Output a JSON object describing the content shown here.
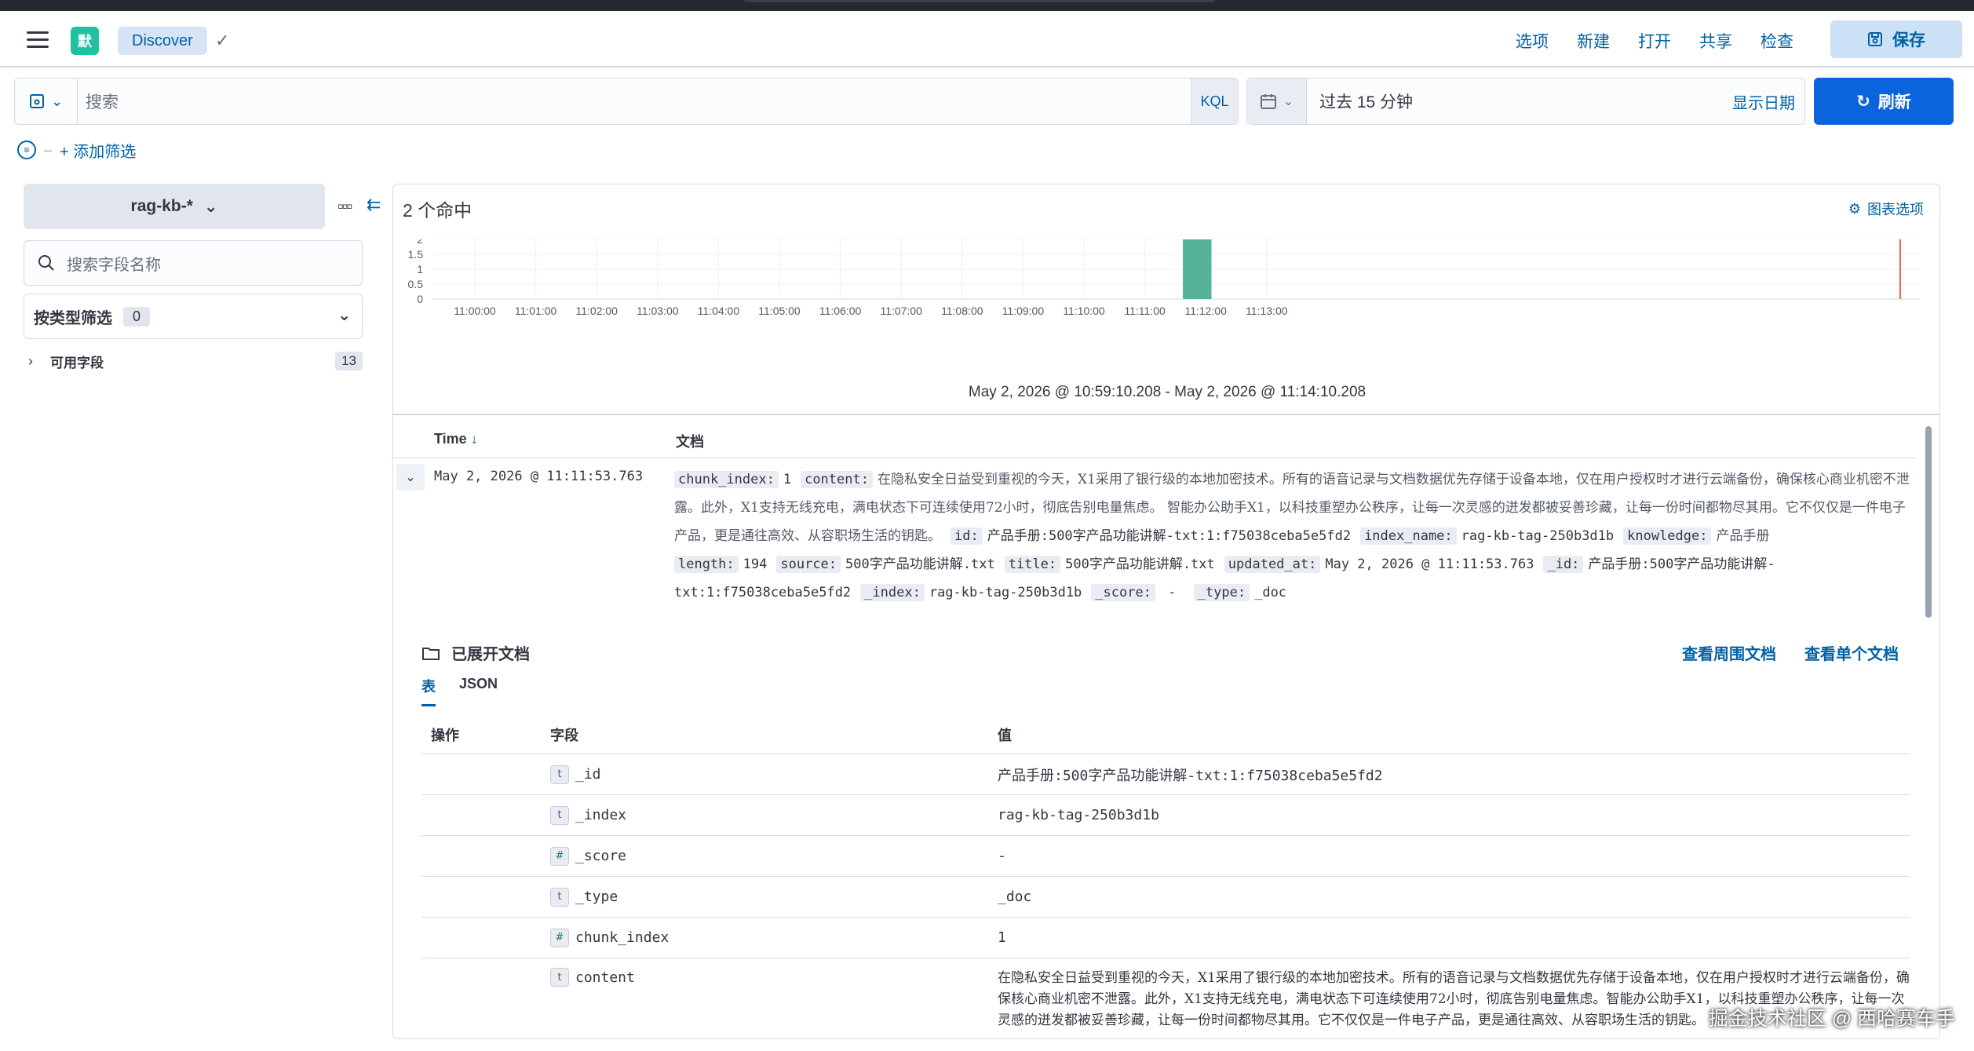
{
  "header": {
    "space_initial": "默",
    "app_tab": "Discover",
    "links": [
      "选项",
      "新建",
      "打开",
      "共享",
      "检查"
    ],
    "save_label": "保存"
  },
  "query": {
    "placeholder": "搜索",
    "language": "KQL",
    "time_range": "过去 15 分钟",
    "show_dates": "显示日期",
    "refresh_label": "刷新"
  },
  "filters": {
    "add_label": "+ 添加筛选"
  },
  "sidebar": {
    "index_pattern": "rag-kb-*",
    "field_search_placeholder": "搜索字段名称",
    "type_filter_label": "按类型筛选",
    "type_filter_count": "0",
    "available_fields_label": "可用字段",
    "available_fields_count": "13"
  },
  "results": {
    "hits": "2 个命中",
    "chart_options": "图表选项",
    "range_label": "May 2, 2026 @ 10:59:10.208 - May 2, 2026 @ 11:14:10.208",
    "col_time": "Time",
    "col_doc": "文档"
  },
  "chart_data": {
    "type": "bar",
    "categories": [
      "11:00:00",
      "11:01:00",
      "11:02:00",
      "11:03:00",
      "11:04:00",
      "11:05:00",
      "11:06:00",
      "11:07:00",
      "11:08:00",
      "11:09:00",
      "11:10:00",
      "11:11:00",
      "11:12:00",
      "11:13:00"
    ],
    "values": [
      0,
      0,
      0,
      0,
      0,
      0,
      0,
      0,
      0,
      0,
      0,
      0,
      2,
      0
    ],
    "yticks": [
      "2",
      "1.5",
      "1",
      "0.5",
      "0"
    ],
    "ylim": [
      0,
      2
    ],
    "bar_color": "#54b399",
    "now_marker_color": "#e7664c"
  },
  "document": {
    "time": "May 2, 2026 @ 11:11:53.763",
    "pairs": [
      {
        "k": "chunk_index:",
        "v": "1",
        "t": "v"
      },
      {
        "k": "content:",
        "v": "在隐私安全日益受到重视的今天，X1采用了银行级的本地加密技术。所有的语音记录与文档数据优先存储于设备本地，仅在用户授权时才进行云端备份，确保核心商业机密不泄露。此外，X1支持无线充电，满电状态下可连续使用72小时，彻底告别电量焦虑。 智能办公助手X1，以科技重塑办公秩序，让每一次灵感的迸发都被妥善珍藏，让每一份时间都物尽其用。它不仅仅是一件电子产品，更是通往高效、从容职场生活的钥匙。",
        "t": "z"
      },
      {
        "k": "id:",
        "v": "产品手册:500字产品功能讲解-txt:1:f75038ceba5e5fd2",
        "t": "v"
      },
      {
        "k": "index_name:",
        "v": "rag-kb-tag-250b3d1b",
        "t": "v"
      },
      {
        "k": "knowledge:",
        "v": "产品手册",
        "t": "z"
      },
      {
        "k": "length:",
        "v": "194",
        "t": "v"
      },
      {
        "k": "source:",
        "v": "500字产品功能讲解.txt",
        "t": "v"
      },
      {
        "k": "title:",
        "v": "500字产品功能讲解.txt",
        "t": "v"
      },
      {
        "k": "updated_at:",
        "v": "May 2, 2026 @ 11:11:53.763",
        "t": "v"
      },
      {
        "k": "_id:",
        "v": "产品手册:500字产品功能讲解-txt:1:f75038ceba5e5fd2",
        "t": "v"
      },
      {
        "k": "_index:",
        "v": "rag-kb-tag-250b3d1b",
        "t": "v"
      },
      {
        "k": "_score:",
        "v": " - ",
        "t": "v"
      },
      {
        "k": "_type:",
        "v": "_doc",
        "t": "v"
      }
    ]
  },
  "expanded": {
    "title": "已展开文档",
    "view_surrounding": "查看周围文档",
    "view_single": "查看单个文档",
    "tab_table": "表",
    "tab_json": "JSON",
    "col_action": "操作",
    "col_field": "字段",
    "col_value": "值",
    "rows": [
      {
        "type": "t",
        "field": "_id",
        "value": "产品手册:500字产品功能讲解-txt:1:f75038ceba5e5fd2"
      },
      {
        "type": "t",
        "field": "_index",
        "value": "rag-kb-tag-250b3d1b"
      },
      {
        "type": "#",
        "field": "_score",
        "value": " -"
      },
      {
        "type": "t",
        "field": "_type",
        "value": "_doc"
      },
      {
        "type": "#",
        "field": "chunk_index",
        "value": "1"
      }
    ],
    "content_row": {
      "type": "t",
      "field": "content",
      "value": "在隐私安全日益受到重视的今天，X1采用了银行级的本地加密技术。所有的语音记录与文档数据优先存储于设备本地，仅在用户授权时才进行云端备份，确保核心商业机密不泄露。此外，X1支持无线充电，满电状态下可连续使用72小时，彻底告别电量焦虑。智能办公助手X1，以科技重塑办公秩序，让每一次灵感的迸发都被妥善珍藏，让每一份时间都物尽其用。它不仅仅是一件电子产品，更是通往高效、从容职场生活的钥匙。"
    }
  },
  "watermark": "掘金技术社区 @ 西哈赛车手"
}
